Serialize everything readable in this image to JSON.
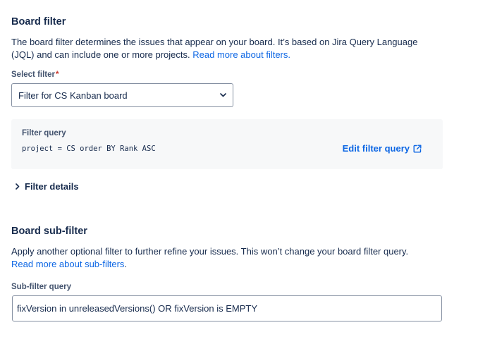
{
  "board_filter": {
    "heading": "Board filter",
    "description": "The board filter determines the issues that appear on your board. It’s based on Jira Query Language (JQL) and can include one or more projects.",
    "read_more_link": "Read more about filters.",
    "select_label": "Select filter",
    "required_marker": "*",
    "selected_value": "Filter for CS Kanban board",
    "query_label": "Filter query",
    "query_value": "project = CS order BY Rank ASC",
    "edit_link": "Edit filter query",
    "details_toggle": "Filter details"
  },
  "sub_filter": {
    "heading": "Board sub-filter",
    "description": "Apply another optional filter to further refine your issues. This won’t change your board filter query.",
    "read_more_link": "Read more about sub-filters",
    "read_more_suffix": ".",
    "input_label": "Sub-filter query",
    "input_value": "fixVersion in unreleasedVersions() OR fixVersion is EMPTY"
  },
  "colors": {
    "link": "#0c66e4",
    "text": "#172b4d",
    "required": "#c9372c",
    "panel_bg": "#f7f8f9"
  },
  "icons": {
    "select": "chevron-down-icon",
    "edit": "external-link-icon",
    "details": "chevron-right-icon"
  }
}
